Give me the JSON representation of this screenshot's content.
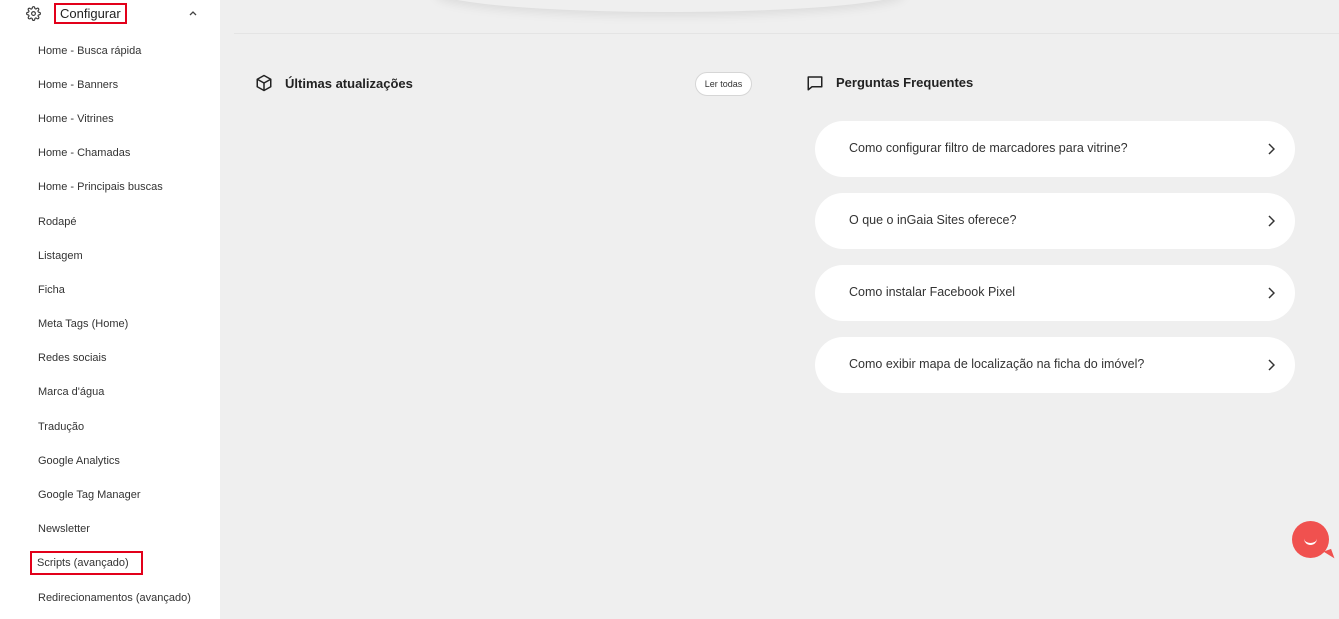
{
  "sidebar": {
    "section_title": "Configurar",
    "section_icon": "gear-icon",
    "expand_icon": "chevron-up-icon",
    "items": [
      {
        "label": "Home - Busca rápida"
      },
      {
        "label": "Home - Banners"
      },
      {
        "label": "Home - Vitrines"
      },
      {
        "label": "Home - Chamadas"
      },
      {
        "label": "Home - Principais buscas"
      },
      {
        "label": "Rodapé"
      },
      {
        "label": "Listagem"
      },
      {
        "label": "Ficha"
      },
      {
        "label": "Meta Tags (Home)"
      },
      {
        "label": "Redes sociais"
      },
      {
        "label": "Marca d'água"
      },
      {
        "label": "Tradução"
      },
      {
        "label": "Google Analytics"
      },
      {
        "label": "Google Tag Manager"
      },
      {
        "label": "Newsletter"
      },
      {
        "label": "Scripts (avançado)"
      },
      {
        "label": "Redirecionamentos (avançado)"
      }
    ]
  },
  "updates": {
    "title": "Últimas atualizações",
    "read_all_label": "Ler todas"
  },
  "faq": {
    "title": "Perguntas Frequentes",
    "questions": [
      {
        "text": "Como configurar filtro de marcadores para vitrine?"
      },
      {
        "text": "O que o inGaia Sites oferece?"
      },
      {
        "text": "Como instalar Facebook Pixel"
      },
      {
        "text": "Como exibir mapa de localização na ficha do imóvel?"
      }
    ]
  },
  "colors": {
    "highlight": "#e2001a",
    "chat_accent": "#f0514f",
    "background": "#efefef"
  }
}
